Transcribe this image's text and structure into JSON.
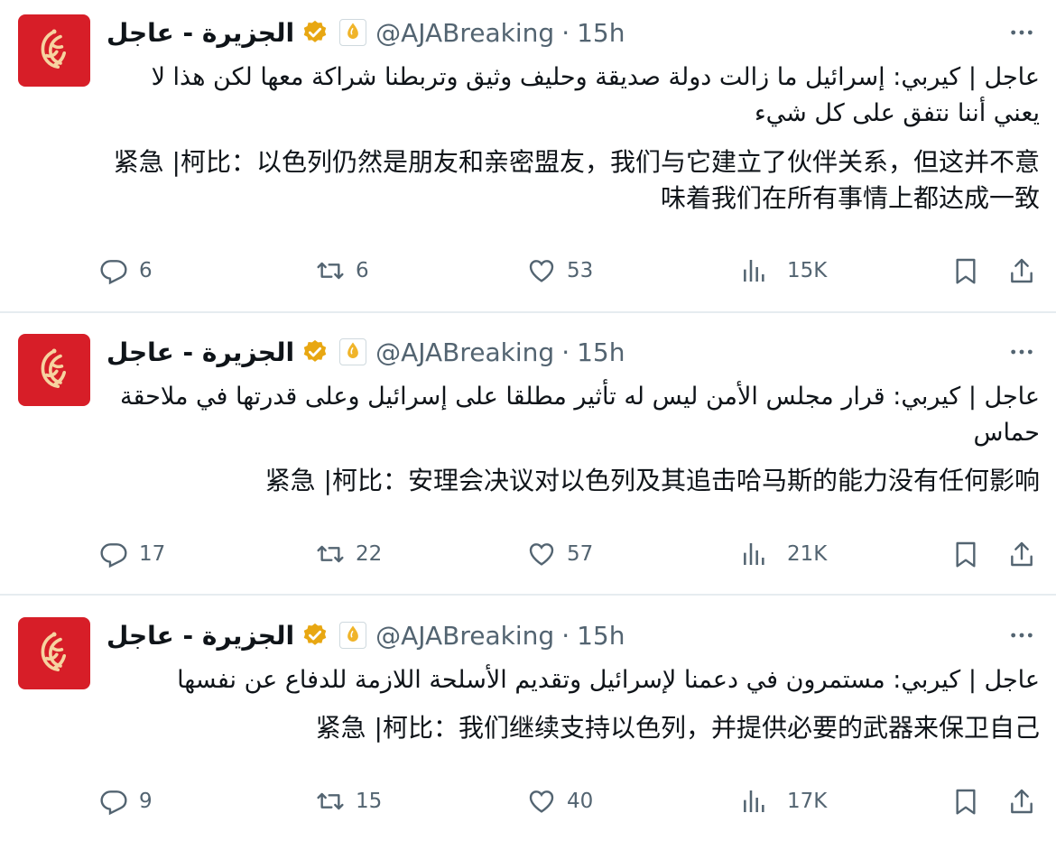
{
  "account": {
    "name": "الجزيرة - عاجل",
    "handle": "@AJABreaking",
    "dot": "·",
    "colors": {
      "brand": "#d71e28",
      "verified": "#e8a712",
      "muted": "#536471",
      "text": "#0f1419"
    }
  },
  "tweets": [
    {
      "time": "15h",
      "text_ar": "عاجل | كيربي: إسرائيل ما زالت دولة صديقة وحليف وثيق وتربطنا شراكة معها لكن هذا لا يعني أننا نتفق على كل شيء",
      "text_zh": "紧急 |柯比：以色列仍然是朋友和亲密盟友，我们与它建立了伙伴关系，但这并不意味着我们在所有事情上都达成一致",
      "replies": "6",
      "retweets": "6",
      "likes": "53",
      "views": "15K"
    },
    {
      "time": "15h",
      "text_ar": "عاجل | كيربي: قرار مجلس الأمن ليس له تأثير مطلقا على إسرائيل وعلى قدرتها في ملاحقة حماس",
      "text_zh": "紧急 |柯比：安理会决议对以色列及其追击哈马斯的能力没有任何影响",
      "replies": "17",
      "retweets": "22",
      "likes": "57",
      "views": "21K"
    },
    {
      "time": "15h",
      "text_ar": "عاجل | كيربي: مستمرون في دعمنا لإسرائيل وتقديم الأسلحة اللازمة للدفاع عن نفسها",
      "text_zh": "紧急 |柯比：我们继续支持以色列，并提供必要的武器来保卫自己",
      "replies": "9",
      "retweets": "15",
      "likes": "40",
      "views": "17K"
    }
  ]
}
